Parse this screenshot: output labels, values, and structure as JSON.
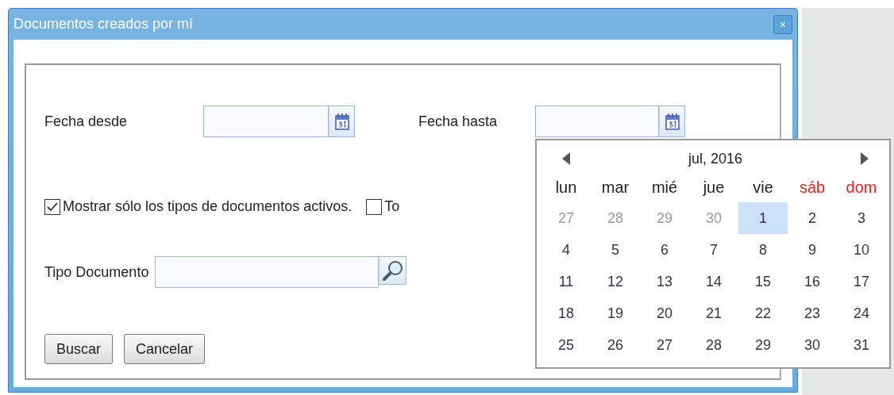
{
  "window": {
    "title": "Documentos creados por mí",
    "close_label": "×"
  },
  "form": {
    "fecha_desde": {
      "label": "Fecha desde"
    },
    "fecha_hasta": {
      "label": "Fecha hasta"
    },
    "checkboxes": [
      {
        "label": "Mostrar sólo los tipos de documentos activos.",
        "checked": true
      },
      {
        "label": "To",
        "checked": false
      }
    ],
    "tipo_documento": {
      "label": "Tipo Documento"
    },
    "buttons": [
      "Buscar",
      "Cancelar"
    ]
  },
  "calendar": {
    "month": "jul, 2016",
    "weekdays": [
      {
        "label": "lun",
        "weekend": false
      },
      {
        "label": "mar",
        "weekend": false
      },
      {
        "label": "mié",
        "weekend": false
      },
      {
        "label": "jue",
        "weekend": false
      },
      {
        "label": "vie",
        "weekend": false
      },
      {
        "label": "sáb",
        "weekend": true
      },
      {
        "label": "dom",
        "weekend": true
      }
    ],
    "weeks": [
      [
        {
          "day": "27",
          "outside": true,
          "selected": false
        },
        {
          "day": "28",
          "outside": true,
          "selected": false
        },
        {
          "day": "29",
          "outside": true,
          "selected": false
        },
        {
          "day": "30",
          "outside": true,
          "selected": false
        },
        {
          "day": "1",
          "outside": false,
          "selected": true
        },
        {
          "day": "2",
          "outside": false,
          "selected": false
        },
        {
          "day": "3",
          "outside": false,
          "selected": false
        }
      ],
      [
        {
          "day": "4",
          "outside": false,
          "selected": false
        },
        {
          "day": "5",
          "outside": false,
          "selected": false
        },
        {
          "day": "6",
          "outside": false,
          "selected": false
        },
        {
          "day": "7",
          "outside": false,
          "selected": false
        },
        {
          "day": "8",
          "outside": false,
          "selected": false
        },
        {
          "day": "9",
          "outside": false,
          "selected": false
        },
        {
          "day": "10",
          "outside": false,
          "selected": false
        }
      ],
      [
        {
          "day": "11",
          "outside": false,
          "selected": false
        },
        {
          "day": "12",
          "outside": false,
          "selected": false
        },
        {
          "day": "13",
          "outside": false,
          "selected": false
        },
        {
          "day": "14",
          "outside": false,
          "selected": false
        },
        {
          "day": "15",
          "outside": false,
          "selected": false
        },
        {
          "day": "16",
          "outside": false,
          "selected": false
        },
        {
          "day": "17",
          "outside": false,
          "selected": false
        }
      ],
      [
        {
          "day": "18",
          "outside": false,
          "selected": false
        },
        {
          "day": "19",
          "outside": false,
          "selected": false
        },
        {
          "day": "20",
          "outside": false,
          "selected": false
        },
        {
          "day": "21",
          "outside": false,
          "selected": false
        },
        {
          "day": "22",
          "outside": false,
          "selected": false
        },
        {
          "day": "23",
          "outside": false,
          "selected": false
        },
        {
          "day": "24",
          "outside": false,
          "selected": false
        }
      ],
      [
        {
          "day": "25",
          "outside": false,
          "selected": false
        },
        {
          "day": "26",
          "outside": false,
          "selected": false
        },
        {
          "day": "27",
          "outside": false,
          "selected": false
        },
        {
          "day": "28",
          "outside": false,
          "selected": false
        },
        {
          "day": "29",
          "outside": false,
          "selected": false
        },
        {
          "day": "30",
          "outside": false,
          "selected": false
        },
        {
          "day": "31",
          "outside": false,
          "selected": false
        }
      ]
    ]
  }
}
